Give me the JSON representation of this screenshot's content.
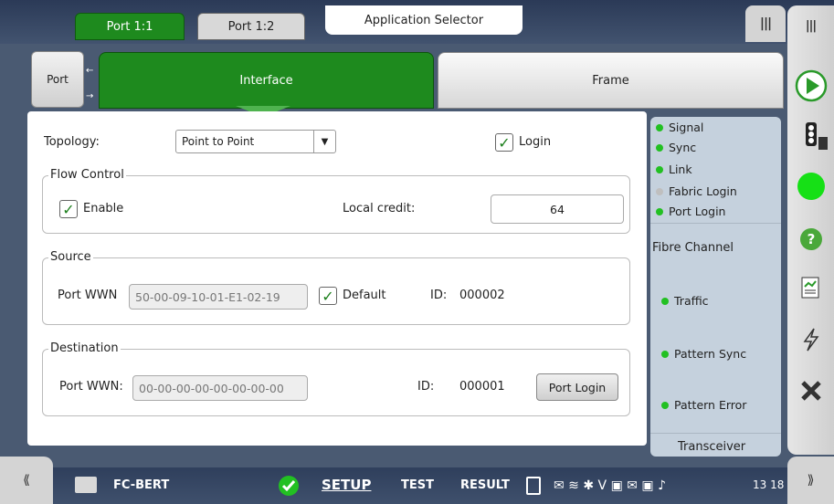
{
  "header": {
    "tabs": [
      {
        "label": "Port 1:1",
        "active": true
      },
      {
        "label": "Port 1:2",
        "active": false
      }
    ],
    "app_selector": "Application Selector",
    "menu_icon": "|||"
  },
  "subtabs": {
    "port": "Port",
    "interface": "Interface",
    "frame": "Frame"
  },
  "form": {
    "topology_label": "Topology:",
    "topology_value": "Point to Point",
    "login_label": "Login",
    "flow_control": {
      "title": "Flow Control",
      "enable_label": "Enable",
      "local_credit_label": "Local credit:",
      "local_credit_value": "64"
    },
    "source": {
      "title": "Source",
      "port_wwn_label": "Port WWN",
      "port_wwn_value": "50-00-09-10-01-E1-02-19",
      "default_label": "Default",
      "id_label": "ID:",
      "id_value": "000002"
    },
    "destination": {
      "title": "Destination",
      "port_wwn_label": "Port WWN:",
      "port_wwn_value": "00-00-00-00-00-00-00-00",
      "id_label": "ID:",
      "id_value": "000001",
      "port_login_button": "Port Login"
    }
  },
  "status": {
    "items": [
      {
        "label": "Signal",
        "color": "#22c022"
      },
      {
        "label": "Sync",
        "color": "#22c022"
      },
      {
        "label": "Link",
        "color": "#22c022"
      },
      {
        "label": "Fabric Login",
        "color": "#bfbfbf"
      },
      {
        "label": "Port Login",
        "color": "#22c022"
      }
    ],
    "section": "Fibre Channel",
    "lower": [
      {
        "label": "Traffic",
        "color": "#22c022"
      },
      {
        "label": "Pattern Sync",
        "color": "#22c022"
      },
      {
        "label": "Pattern Error",
        "color": "#22c022"
      }
    ],
    "transceiver": "Transceiver"
  },
  "footer": {
    "app_name": "FC-BERT",
    "setup": "SETUP",
    "test": "TEST",
    "result": "RESULT",
    "time": "13 18",
    "left_collapse": "⟪",
    "right_collapse": "⟫"
  }
}
